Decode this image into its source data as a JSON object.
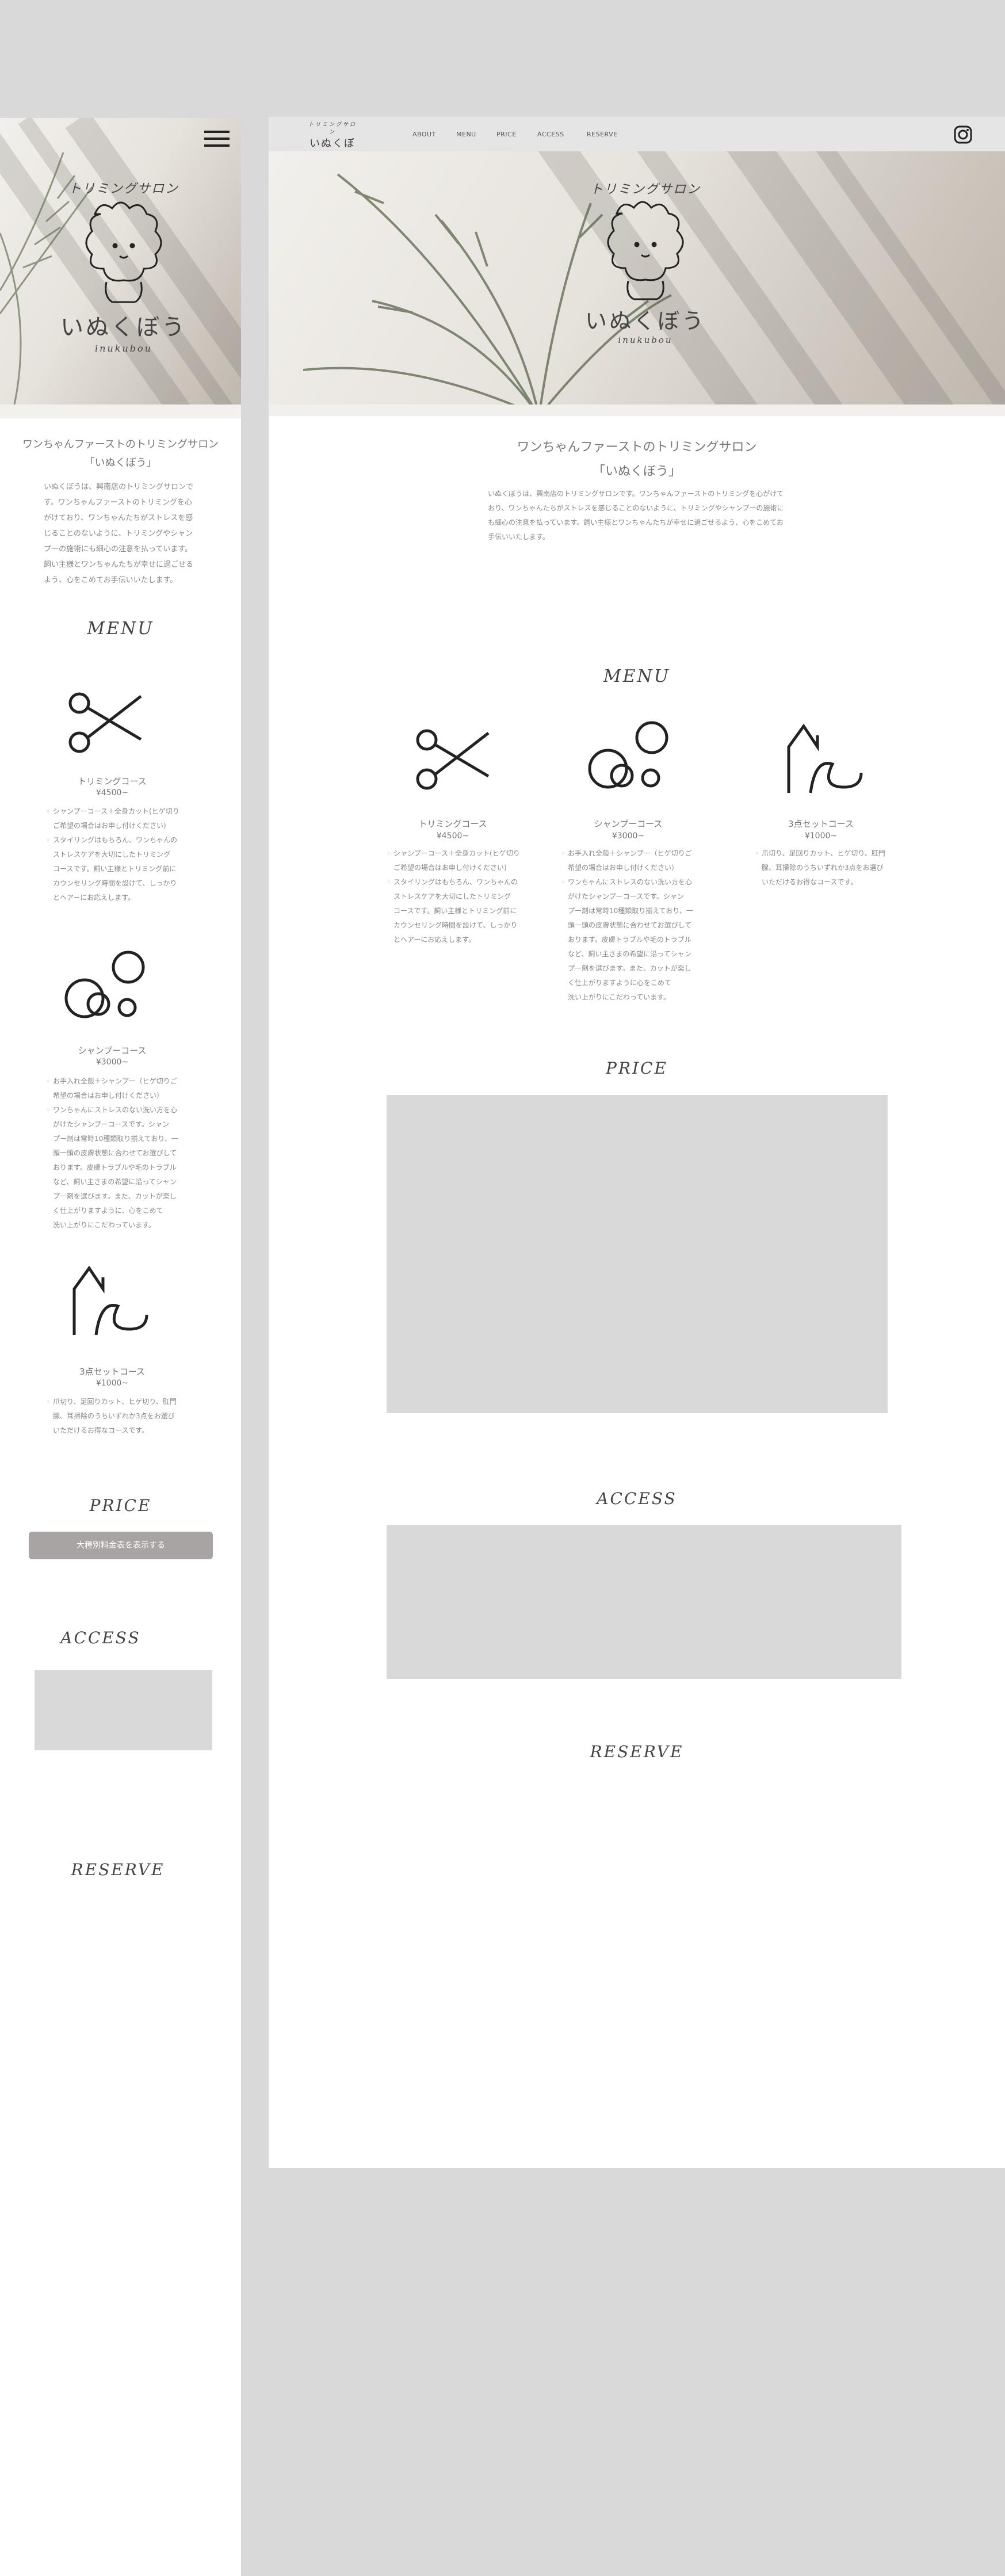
{
  "brand": {
    "tagline": "トリミングサロン",
    "name": "いぬくぼう",
    "romaji": "inukubou"
  },
  "nav": [
    "ABOUT",
    "MENU",
    "PRICE",
    "ACCESS",
    "RESERVE"
  ],
  "about": {
    "title_line1": "ワンちゃんファーストのトリミングサロン",
    "title_line2": "「いぬくぼう」",
    "mobile_desc": [
      "いぬくぼうは、興南店のトリミングサロンで",
      "す。ワンちゃんファーストのトリミングを心",
      "がけており、ワンちゃんたちがストレスを感",
      "じることのないように、トリミングやシャン",
      "プーの施術にも細心の注意を払っています。",
      "飼い主様とワンちゃんたちが幸せに過ごせる",
      "よう、心をこめてお手伝いいたします。"
    ],
    "desktop_desc": [
      "いぬくぼうは、興南店のトリミングサロンです。ワンちゃんファーストのトリミングを心がけて",
      "おり、ワンちゃんたちがストレスを感じることのないように、トリミングやシャンプーの施術に",
      "も細心の注意を払っています。飼い主様とワンちゃんたちが幸せに過ごせるよう、心をこめてお",
      "手伝いいたします。"
    ]
  },
  "menu_heading": "MENU",
  "price_heading": "PRICE",
  "access_heading": "ACCESS",
  "reserve_heading": "RESERVE",
  "price_button": "大種別料金表を表示する",
  "courses": [
    {
      "name": "トリミングコース",
      "price": "¥4500~",
      "icon": "scissors-icon",
      "mobile_notes": [
        [
          "シャンプーコース＋全身カット(ヒゲ切り",
          "ご希望の場合はお申し付けください)"
        ],
        [
          "スタイリングはもちろん、ワンちゃんの",
          "ストレスケアを大切にしたトリミング",
          "コースです。飼い主様とトリミング前に",
          "カウンセリング時間を設けて、しっかり",
          "とヘアーにお応えします。"
        ]
      ],
      "desktop_notes": [
        [
          "シャンプーコース＋全身カット(ヒゲ切り",
          "ご希望の場合はお申し付けください)"
        ],
        [
          "スタイリングはもちろん、ワンちゃんの",
          "ストレスケアを大切にしたトリミング",
          "コースです。飼い主様とトリミング前に",
          "カウンセリング時間を設けて、しっかり",
          "とヘアーにお応えします。"
        ]
      ]
    },
    {
      "name": "シャンプーコース",
      "price": "¥3000~",
      "icon": "bubbles-icon",
      "mobile_notes": [
        [
          "お手入れ全般＋シャンプー（ヒゲ切りご",
          "希望の場合はお申し付けください）"
        ],
        [
          "ワンちゃんにストレスのない洗い方を心",
          "がけたシャンプーコースです。シャン",
          "プー剤は常時10種類取り揃えており、一",
          "頭一頭の皮膚状態に合わせてお選びして",
          "おります。皮膚トラブルや毛のトラブル",
          "など、飼い主さまの希望に沿ってシャン",
          "プー剤を選びます。また、カットが楽し",
          "く仕上がりますように、心をこめて",
          "洗い上がりにこだわっています。"
        ]
      ],
      "desktop_notes": [
        [
          "お手入れ全般＋シャンプー（ヒゲ切りご",
          "希望の場合はお申し付けください）"
        ],
        [
          "ワンちゃんにストレスのない洗い方を心",
          "がけたシャンプーコースです。シャン",
          "プー剤は常時10種類取り揃えており、一",
          "頭一頭の皮膚状態に合わせてお選びして",
          "おります。皮膚トラブルや毛のトラブル",
          "など、飼い主さまの希望に沿ってシャン",
          "プー剤を選びます。また、カットが楽し",
          "く仕上がりますように心をこめて",
          "洗い上がりにこだわっています。"
        ]
      ]
    },
    {
      "name": "3点セットコース",
      "price": "¥1000~",
      "icon": "paw-icon",
      "mobile_notes": [
        [
          "爪切り、足回りカット、ヒゲ切り、肛門",
          "腺、耳掃除のうちいずれか3点をお選び",
          "いただけるお得なコースです。"
        ]
      ],
      "desktop_notes": [
        [
          "爪切り、足回りカット、ヒゲ切り、肛門",
          "腺、耳掃除のうちいずれか3点をお選び",
          "いただけるお得なコースです。"
        ]
      ]
    }
  ],
  "colors": {
    "canvas": "#d9d9d9",
    "panel": "#ffffff",
    "navbar": "#e5e5e5",
    "button": "#a9a4a4",
    "placeholder": "#d9d9d9"
  }
}
